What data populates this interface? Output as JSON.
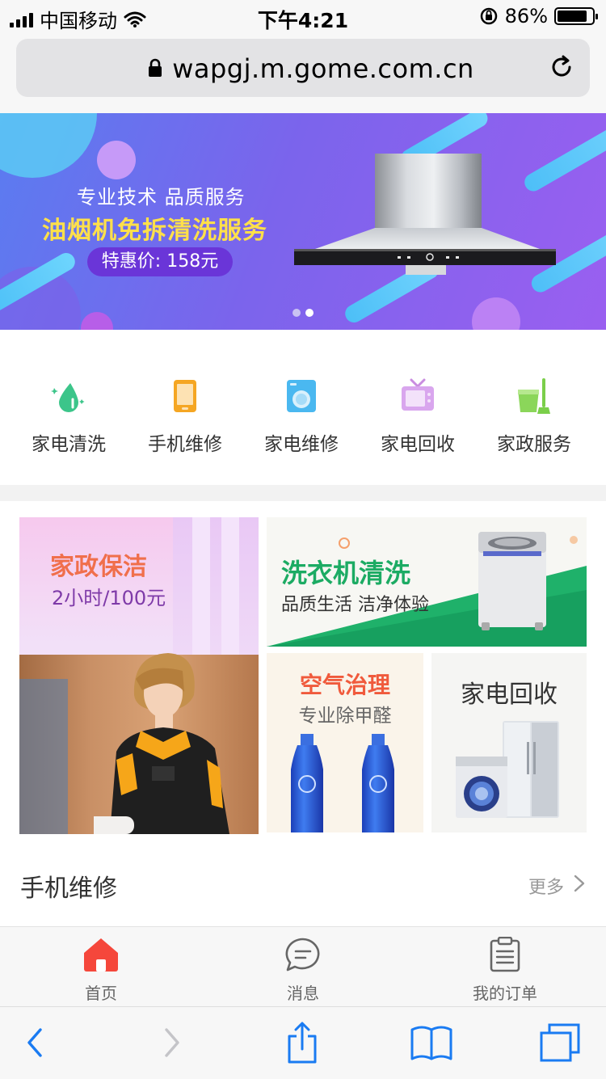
{
  "status_bar": {
    "carrier": "中国移动",
    "time": "下午4:21",
    "battery_percent": "86%",
    "battery_level": 0.86,
    "signal_bars": 4
  },
  "browser": {
    "url": "wapgj.m.gome.com.cn",
    "lock_icon": "lock-icon",
    "reload_icon": "reload-icon"
  },
  "banner": {
    "tagline": "专业技术   品质服务",
    "headline": "油烟机免拆清洗服务",
    "price": "特惠价: 158元",
    "image": "range-hood",
    "slides": 2,
    "active_slide": 2
  },
  "categories": [
    {
      "label": "家电清洗",
      "icon": "water-drop-icon",
      "color": "#3cc58a"
    },
    {
      "label": "手机维修",
      "icon": "phone-icon",
      "color": "#f5a623"
    },
    {
      "label": "家电维修",
      "icon": "washer-icon",
      "color": "#4ab8f0"
    },
    {
      "label": "家电回收",
      "icon": "tv-icon",
      "color": "#c98ce0"
    },
    {
      "label": "家政服务",
      "icon": "bucket-mop-icon",
      "color": "#7bcf4a"
    }
  ],
  "promos": {
    "housekeeping": {
      "title": "家政保洁",
      "subtitle": "2小时/100元"
    },
    "washer": {
      "title": "洗衣机清洗",
      "subtitle": "品质生活 洁净体验"
    },
    "air": {
      "title": "空气治理",
      "subtitle": "专业除甲醛"
    },
    "recycle": {
      "title": "家电回收"
    }
  },
  "section": {
    "title": "手机维修",
    "more": "更多"
  },
  "tabs": [
    {
      "label": "首页",
      "icon": "home-icon",
      "active": true
    },
    {
      "label": "消息",
      "icon": "message-icon",
      "active": false
    },
    {
      "label": "我的订单",
      "icon": "order-list-icon",
      "active": false
    }
  ],
  "colors": {
    "accent": "#f5473b",
    "toolbar_blue": "#1a7bf2"
  }
}
